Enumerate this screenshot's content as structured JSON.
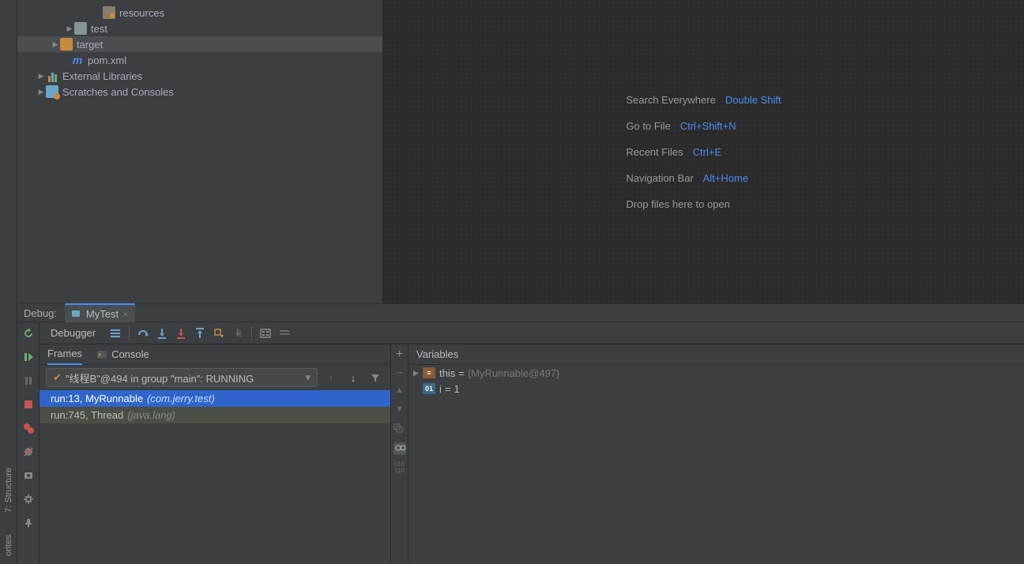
{
  "project": {
    "tree": [
      {
        "indent": 96,
        "arrow": "",
        "icon": "folder-r",
        "label": "resources"
      },
      {
        "indent": 60,
        "arrow": "r",
        "icon": "folder",
        "label": "test"
      },
      {
        "indent": 42,
        "arrow": "r",
        "icon": "folder-y",
        "label": "target",
        "selected": true
      },
      {
        "indent": 56,
        "arrow": "",
        "icon": "m",
        "label": "pom.xml"
      },
      {
        "indent": 24,
        "arrow": "r",
        "icon": "lib",
        "label": "External Libraries"
      },
      {
        "indent": 24,
        "arrow": "r",
        "icon": "scratch",
        "label": "Scratches and Consoles"
      }
    ]
  },
  "hints": [
    {
      "label": "Search Everywhere",
      "shortcut": "Double Shift"
    },
    {
      "label": "Go to File",
      "shortcut": "Ctrl+Shift+N"
    },
    {
      "label": "Recent Files",
      "shortcut": "Ctrl+E"
    },
    {
      "label": "Navigation Bar",
      "shortcut": "Alt+Home"
    },
    {
      "label": "Drop files here to open",
      "shortcut": ""
    }
  ],
  "debug": {
    "label": "Debug:",
    "tab": "MyTest",
    "debugger_tab": "Debugger",
    "frames_tab": "Frames",
    "console_tab": "Console",
    "variables_tab": "Variables",
    "thread": "\"线程B\"@494 in group \"main\": RUNNING",
    "frames": [
      {
        "text": "run:13, MyRunnable",
        "pkg": "(com.jerry.test)",
        "sel": true
      },
      {
        "text": "run:745, Thread",
        "pkg": "(java.lang)",
        "dim": true
      }
    ],
    "vars": [
      {
        "arrow": "r",
        "icon": "this",
        "name": "this",
        "eq": " = ",
        "value": "{MyRunnable@497}"
      },
      {
        "arrow": "",
        "icon": "int",
        "name": "i",
        "eq": " = ",
        "value": "1",
        "vcolor": "#bbb"
      }
    ]
  },
  "leftbar": {
    "structure": "7: Structure",
    "favorites": "orites"
  }
}
